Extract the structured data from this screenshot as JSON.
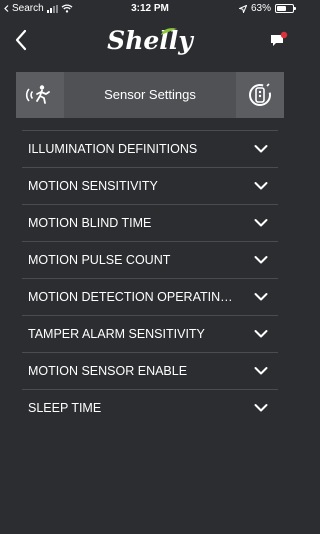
{
  "status_bar": {
    "carrier": "Search",
    "time": "3:12 PM",
    "battery_percent": "63%",
    "battery_level": 0.63
  },
  "header": {
    "logo_text": "Shelly",
    "back_icon": "chevron-left-icon",
    "chat_icon": "chat-notification-icon",
    "brand_color": "#8dc63f",
    "notification_color": "#e0303a"
  },
  "sensor_bar": {
    "title": "Sensor Settings",
    "left_icon": "motion-sensor-icon",
    "right_icon": "device-settings-icon"
  },
  "settings": [
    {
      "label": "ILLUMINATION DEFINITIONS"
    },
    {
      "label": "MOTION SENSITIVITY"
    },
    {
      "label": "MOTION BLIND TIME"
    },
    {
      "label": "MOTION PULSE COUNT"
    },
    {
      "label": "MOTION DETECTION OPERATING M..."
    },
    {
      "label": "TAMPER ALARM SENSITIVITY"
    },
    {
      "label": "MOTION SENSOR ENABLE"
    },
    {
      "label": "SLEEP TIME"
    }
  ]
}
